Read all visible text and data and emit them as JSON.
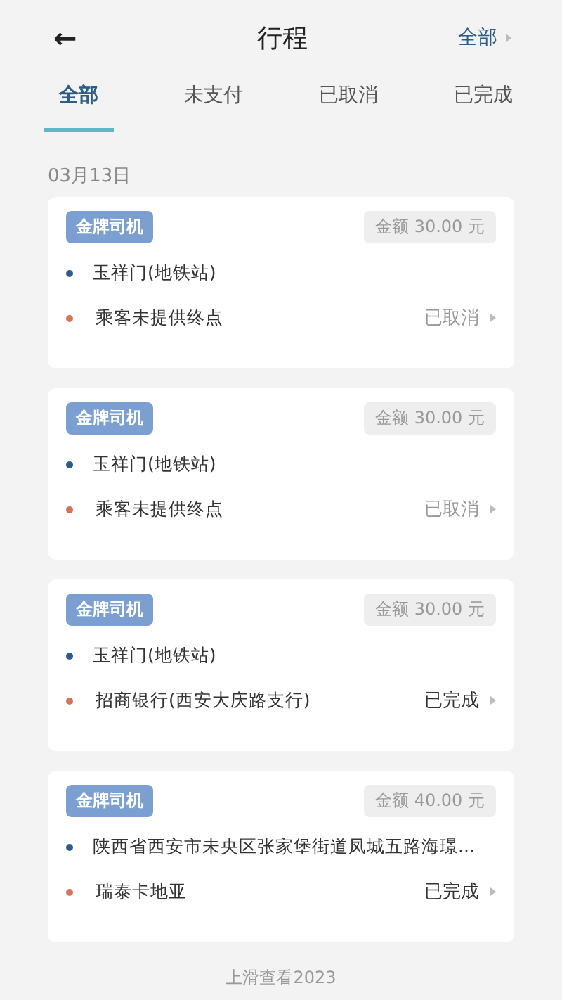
{
  "header": {
    "back": "←",
    "title": "行程",
    "filter": "全部"
  },
  "tabs": [
    {
      "label": "全部",
      "selected": true
    },
    {
      "label": "未支付",
      "selected": false
    },
    {
      "label": "已取消",
      "selected": false
    },
    {
      "label": "已完成",
      "selected": false
    }
  ],
  "date": "03月13日",
  "trips": [
    {
      "badge": "金牌司机",
      "amount": "金额 30.00 元",
      "start": "玉祥门(地铁站)",
      "end": "乘客未提供终点",
      "status": "已取消",
      "completed": false
    },
    {
      "badge": "金牌司机",
      "amount": "金额 30.00 元",
      "start": "玉祥门(地铁站)",
      "end": "乘客未提供终点",
      "status": "已取消",
      "completed": false
    },
    {
      "badge": "金牌司机",
      "amount": "金额 30.00 元",
      "start": "玉祥门(地铁站)",
      "end": "招商银行(西安大庆路支行)",
      "status": "已完成",
      "completed": true
    },
    {
      "badge": "金牌司机",
      "amount": "金额 40.00 元",
      "start": "陕西省西安市未央区张家堡街道凤城五路海璟...",
      "end": "瑞泰卡地亚",
      "status": "已完成",
      "completed": true
    }
  ],
  "footer": "上滑查看2023"
}
